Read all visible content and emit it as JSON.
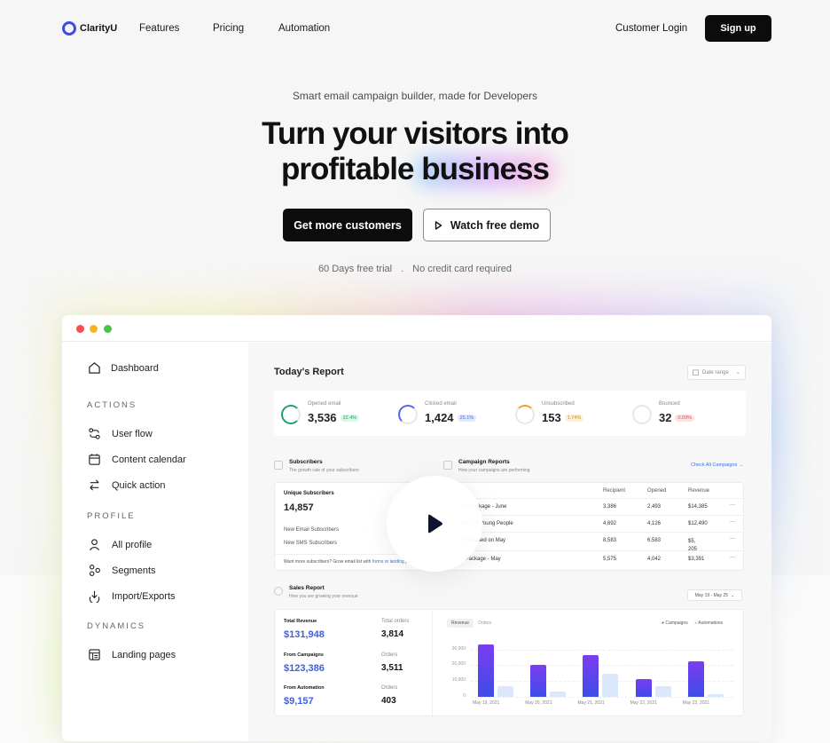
{
  "nav": {
    "brand": "ClarityU",
    "links": [
      "Features",
      "Pricing",
      "Automation"
    ],
    "login": "Customer Login",
    "signup": "Sign up"
  },
  "hero": {
    "tagline": "Smart email campaign builder, made for Developers",
    "headline_line1": "Turn your visitors into",
    "headline_line2_a": "profitable",
    "headline_line2_b": "business",
    "cta_primary": "Get more customers",
    "cta_secondary": "Watch free demo",
    "note_a": "60 Days free trial",
    "note_sep": ".",
    "note_b": "No credit card required"
  },
  "sidebar": {
    "dashboard": "Dashboard",
    "actions_heading": "ACTIONS",
    "actions": [
      "User flow",
      "Content calendar",
      "Quick action"
    ],
    "profile_heading": "PROFILE",
    "profile": [
      "All profile",
      "Segments",
      "Import/Exports"
    ],
    "dynamics_heading": "DYNAMICS",
    "dynamics": [
      "Landing pages"
    ]
  },
  "dashboard": {
    "title": "Today's Report",
    "date_range": "Date range",
    "stats": [
      {
        "label": "Opened email",
        "value": "3,536",
        "change": "32.4%",
        "color": "#22a06b"
      },
      {
        "label": "Clicked email",
        "value": "1,424",
        "change": "25.1%",
        "color": "#4f6ae8"
      },
      {
        "label": "Unsubscribed",
        "value": "153",
        "change": "1.74%",
        "color": "#f0a020"
      },
      {
        "label": "Bounced",
        "value": "32",
        "change": "0.09%",
        "color": "#e84c4c"
      }
    ],
    "subscribers": {
      "title": "Subscribers",
      "subtitle": "The growth rate of your subscribers",
      "unique_label": "Unique Subscribers",
      "unique_value": "14,857",
      "email_label": "New Email Subscribers",
      "sms_label": "New SMS Subscribers",
      "footer": "Want more subscribers? Grow email list with",
      "footer_link": "forms or landing pages"
    },
    "campaigns": {
      "title": "Campaign Reports",
      "subtitle": "How your campaigns are performing",
      "check_all": "Check All Campaigns",
      "headers": [
        "Recipient",
        "Opened",
        "Revenue"
      ],
      "rows": [
        {
          "name": "uty Package - June",
          "recipient": "3,386",
          "opened": "2,493",
          "revenue": "$14,385"
        },
        {
          "name": "gets for Young People",
          "recipient": "4,692",
          "opened": "4,126",
          "revenue": "$12,490"
        },
        {
          "name": "t Released on May",
          "recipient": "8,583",
          "opened": "6,583",
          "revenue": "$5, 205"
        },
        {
          "name": "y Package - May",
          "recipient": "5,575",
          "opened": "4,042",
          "revenue": "$3,391"
        }
      ]
    },
    "sales": {
      "title": "Sales Report",
      "subtitle": "How you are growing your revenue",
      "range": "May 19 - May 25",
      "total_revenue_label": "Total Revenue",
      "total_revenue": "$131,948",
      "total_orders_label": "Total orders",
      "total_orders": "3,814",
      "campaigns_label": "From Campaigns",
      "campaigns_value": "$123,386",
      "campaign_orders_label": "Orders",
      "campaign_orders": "3,511",
      "automation_label": "From Automation",
      "automation_value": "$9,157",
      "automation_orders_label": "Orders",
      "automation_orders": "403",
      "tab_revenue": "Revenue",
      "tab_orders": "Orders",
      "legend": [
        "Campaigns",
        "Automations"
      ]
    }
  },
  "chart_data": {
    "type": "bar",
    "categories": [
      "May 19, 2021",
      "May 20, 2021",
      "May 21, 2021",
      "May 22, 2021",
      "May 23, 2021"
    ],
    "series": [
      {
        "name": "Campaigns",
        "values": [
          33000,
          20000,
          26500,
          11500,
          22500
        ]
      },
      {
        "name": "Automations",
        "values": [
          6500,
          3500,
          14500,
          7000,
          1800
        ]
      }
    ],
    "yticks": [
      "30,000",
      "20,000",
      "10,000",
      "0"
    ],
    "ylim": [
      0,
      36000
    ],
    "colors": [
      "#5b45ea",
      "#dbe7fb"
    ]
  }
}
